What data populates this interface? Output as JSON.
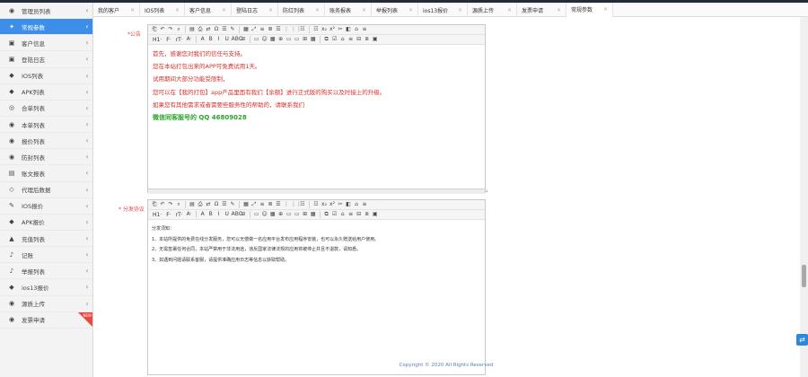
{
  "sidebar": {
    "items": [
      {
        "icon": "◉",
        "label": "管理员列表",
        "active": false
      },
      {
        "icon": "✦",
        "label": "常规参数",
        "active": true
      },
      {
        "icon": "▣",
        "label": "客户信息",
        "active": false
      },
      {
        "icon": "▣",
        "label": "登陆日志",
        "active": false
      },
      {
        "icon": "◆",
        "label": "IOS列表",
        "active": false
      },
      {
        "icon": "◆",
        "label": "APK列表",
        "active": false
      },
      {
        "icon": "◎",
        "label": "合单列表",
        "active": false
      },
      {
        "icon": "◉",
        "label": "本单列表",
        "active": false
      },
      {
        "icon": "◉",
        "label": "报价列表",
        "active": false
      },
      {
        "icon": "◉",
        "label": "防封列表",
        "active": false
      },
      {
        "icon": "▤",
        "label": "账文报表",
        "active": false
      },
      {
        "icon": "◇",
        "label": "代理后数据",
        "active": false
      },
      {
        "icon": "✎",
        "label": "IOS报价",
        "active": false
      },
      {
        "icon": "◆",
        "label": "APK报价",
        "active": false
      },
      {
        "icon": "▲",
        "label": "充值列表",
        "active": false
      },
      {
        "icon": "♪",
        "label": "记账",
        "active": false
      },
      {
        "icon": "♪",
        "label": "举报列表",
        "active": false
      },
      {
        "icon": "◆",
        "label": "ios13报价",
        "active": false
      },
      {
        "icon": "◉",
        "label": "源质上传",
        "active": false
      },
      {
        "icon": "◉",
        "label": "发票申请",
        "active": false,
        "badge": "NEW"
      }
    ]
  },
  "tabs": [
    {
      "label": "我的客户",
      "active": false
    },
    {
      "label": "IOS列表",
      "active": false
    },
    {
      "label": "客户信息",
      "active": false
    },
    {
      "label": "登陆日志",
      "active": false
    },
    {
      "label": "防红列表",
      "active": false
    },
    {
      "label": "账务报表",
      "active": false
    },
    {
      "label": "举报列表",
      "active": false
    },
    {
      "label": "ios13报价",
      "active": false
    },
    {
      "label": "源质上传",
      "active": false
    },
    {
      "label": "发票申请",
      "active": false
    },
    {
      "label": "常规参数",
      "active": true
    }
  ],
  "tab_close": "×",
  "form": {
    "field1_label": "*公告",
    "field2_label": "* 分发协议",
    "editor1_lines": [
      {
        "text": "首先，感谢您对我们的信任与支持。",
        "style": "red"
      },
      {
        "text": "您在本站打包出来的APP可免费试用1天。",
        "style": "red"
      },
      {
        "text": "试用期间大部分功能受限制，",
        "style": "red"
      },
      {
        "text": "您可以在【我的打包】app产品里面有我们【余额】进行正式版的购买以及时接上的升级。",
        "style": "red"
      },
      {
        "text": "如果您有其他需求或者需要些服务性的帮助的，请联系我们",
        "style": "red"
      },
      {
        "text": "微信同客服号的  QQ 46809028",
        "style": "green"
      }
    ],
    "editor2_lines": [
      "分发须知：",
      "1、本站所提供的免费在线分发服务，您可以无偿做一名应用平台发布应用程序安装，也可以永久赠送给用户使用。",
      "2、无需签署任何合同，本站严禁用于非法用途，违反国家法律法规的应用将被停止并且不退款，请知悉。",
      "3、如遇到问题请联系客服，请提供准确应用日志等信息以获取帮助。"
    ]
  },
  "toolbar": {
    "row1": [
      "⎗",
      "↶",
      "↷",
      "⌕",
      "▤",
      "⎙",
      "⇄",
      "Ω",
      "☰",
      "✎",
      "▦",
      "⤢",
      "≡",
      "≣",
      "☰",
      "⋮",
      "⋮⋮",
      "☷",
      "☷",
      "x₂",
      "x²",
      "✂",
      "◧",
      "⌂",
      "≡"
    ],
    "row2": [
      "H1·",
      "F·",
      "rT·",
      "A·",
      "A",
      "B",
      "I",
      "U",
      "ABC",
      "⊞",
      "▭",
      "☺",
      "▦",
      "⊕",
      "▭",
      "▭",
      "⊞",
      "▦",
      "⧉",
      "☑",
      "⌂",
      "≡",
      "⊟",
      "⧈",
      "▣"
    ]
  },
  "footer_text": "Copyright © 2020 All Rights Reserved",
  "float_button_icon": "⇄"
}
